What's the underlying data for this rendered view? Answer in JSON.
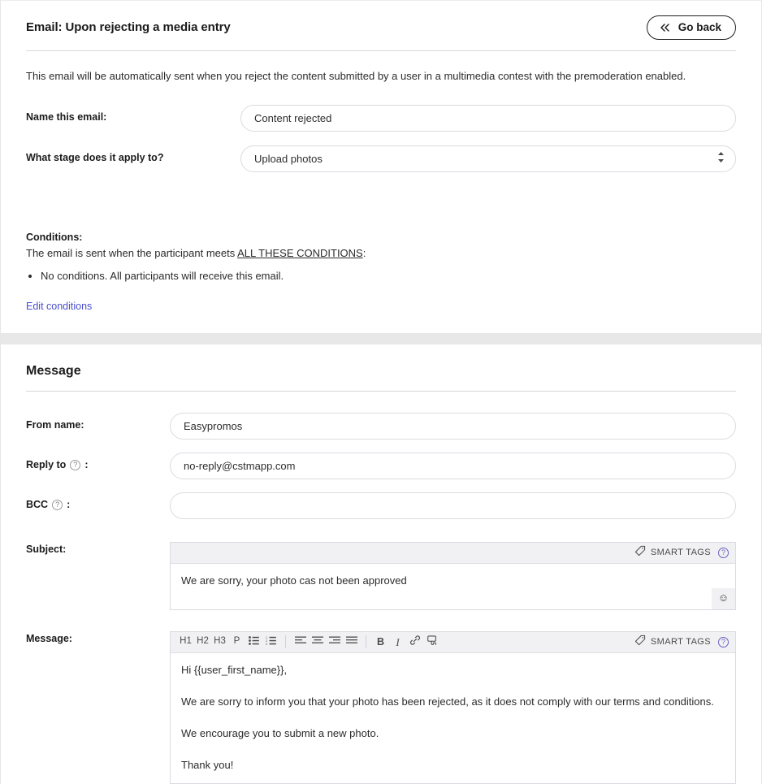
{
  "header": {
    "title": "Email: Upon rejecting a media entry",
    "go_back_label": "Go back",
    "go_back_icon": "double-chevron-left-icon"
  },
  "intro": "This email will be automatically sent when you reject the content submitted by a user in a multimedia contest with the premoderation enabled.",
  "settings": {
    "name_label": "Name this email:",
    "name_value": "Content rejected",
    "name_placeholder": "",
    "stage_label": "What stage does it apply to?",
    "stage_value": "Upload photos",
    "stage_options": [
      "Upload photos"
    ]
  },
  "conditions": {
    "title": "Conditions:",
    "sentence_prefix": "The email is sent when the participant meets ",
    "sentence_link": "ALL THESE CONDITIONS",
    "sentence_suffix": ":",
    "items": [
      "No conditions. All participants will receive this email."
    ],
    "edit_link": "Edit conditions"
  },
  "message": {
    "section_title": "Message",
    "from_label": "From name:",
    "from_value": "Easypromos",
    "from_placeholder": "",
    "reply_label": "Reply to",
    "reply_colon": ":",
    "reply_value": "no-reply@cstmapp.com",
    "reply_placeholder": "",
    "bcc_label": "BCC",
    "bcc_colon": ":",
    "bcc_value": "",
    "bcc_placeholder": "",
    "subject_label": "Subject:",
    "subject_value": "We are sorry, your photo cas not been approved",
    "body_label": "Message:",
    "body_paragraphs": [
      "Hi {{user_first_name}},",
      "We are sorry to inform you that your photo has been rejected, as it does not comply with our terms and conditions.",
      "We encourage you to submit a new photo.",
      "Thank you!"
    ]
  },
  "smart_tags": {
    "label": "SMART TAGS",
    "tag_icon": "tag-icon",
    "help_icon": "help-circle-icon"
  },
  "editor_toolbar": {
    "buttons": [
      {
        "name": "heading-1-button",
        "label": "H1"
      },
      {
        "name": "heading-2-button",
        "label": "H2"
      },
      {
        "name": "heading-3-button",
        "label": "H3"
      },
      {
        "name": "paragraph-button",
        "label": "P"
      }
    ],
    "list_buttons": [
      {
        "name": "bulleted-list-button",
        "icon": "bulleted-list-icon"
      },
      {
        "name": "numbered-list-button",
        "icon": "numbered-list-icon"
      }
    ],
    "align_buttons": [
      {
        "name": "align-left-button",
        "icon": "align-left-icon"
      },
      {
        "name": "align-center-button",
        "icon": "align-center-icon"
      },
      {
        "name": "align-right-button",
        "icon": "align-right-icon"
      },
      {
        "name": "align-justify-button",
        "icon": "align-justify-icon"
      }
    ],
    "format_buttons": [
      {
        "name": "bold-button",
        "label": "B"
      },
      {
        "name": "italic-button",
        "label": "I"
      },
      {
        "name": "insert-link-button",
        "icon": "link-icon"
      },
      {
        "name": "insert-button-button",
        "icon": "button-icon"
      }
    ],
    "emoji_button_icon": "smiley-face-icon"
  },
  "colors": {
    "accent_link": "#4a4fcf",
    "smart_tag_help": "#6c63c4",
    "border": "#d9dbe0",
    "toolbar_bg": "#f1f1f3",
    "section_gap": "#e8e8e8"
  }
}
